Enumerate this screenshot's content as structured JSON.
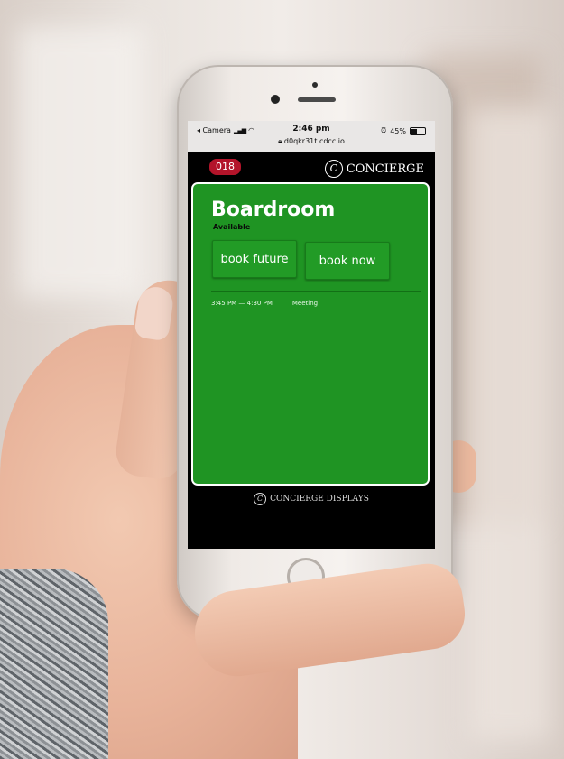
{
  "status_bar": {
    "carrier": "◂ Camera",
    "time": "2:46 pm",
    "url": "d0qkr31t.cdcc.io",
    "battery": "45%"
  },
  "header": {
    "room_number": "018",
    "brand": "CONCIERGE"
  },
  "room": {
    "name": "Boardroom",
    "status": "Available",
    "accent_color": "#1f9423"
  },
  "actions": {
    "book_future_label": "book future",
    "book_now_label": "book now"
  },
  "events": [
    {
      "time": "3:45 PM — 4:30 PM",
      "title": "Meeting"
    }
  ],
  "footer": {
    "brand": "CONCIERGE DISPLAYS"
  },
  "icons": {
    "wifi": "wifi-icon",
    "signal": "signal-icon",
    "battery": "battery-icon",
    "lock": "lock-icon",
    "logo": "concierge-logo-icon"
  }
}
